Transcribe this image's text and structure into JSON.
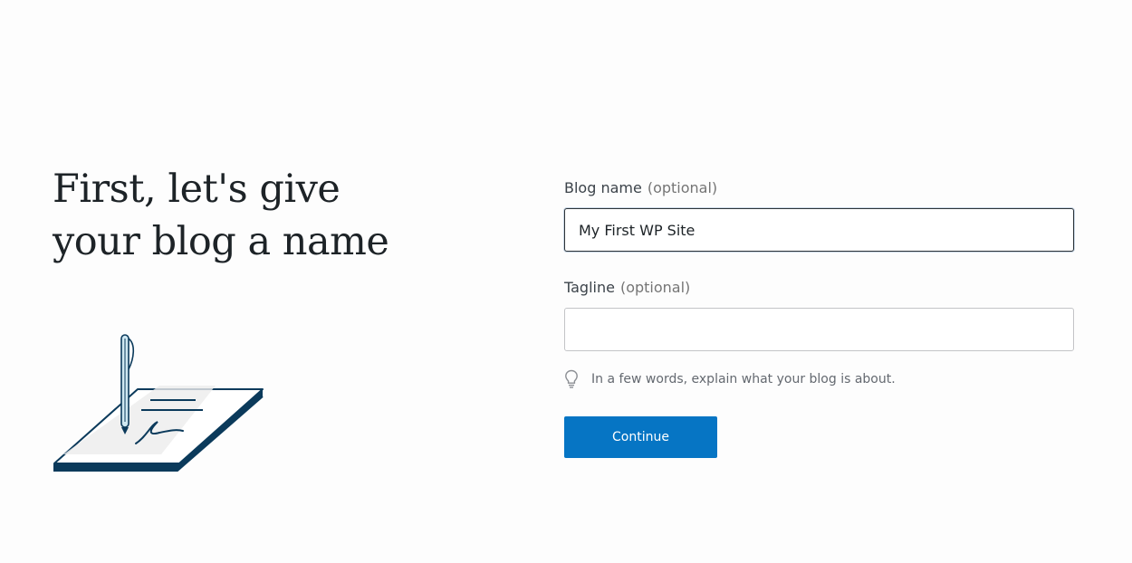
{
  "headline": {
    "line1": "First, let's give",
    "line2": "your blog a name"
  },
  "form": {
    "blog_name": {
      "label": "Blog name",
      "optional": "(optional)",
      "value": "My First WP Site"
    },
    "tagline": {
      "label": "Tagline",
      "optional": "(optional)",
      "value": "",
      "hint": "In a few words, explain what your blog is about."
    },
    "continue_label": "Continue"
  },
  "icons": {
    "illustration": "pen-and-paper-illustration",
    "hint": "lightbulb-icon"
  },
  "colors": {
    "primary_button": "#0675c4",
    "illustration_stroke": "#0b3a5b",
    "pen_accent": "#cfe8f2",
    "background": "#fdfdfd"
  }
}
